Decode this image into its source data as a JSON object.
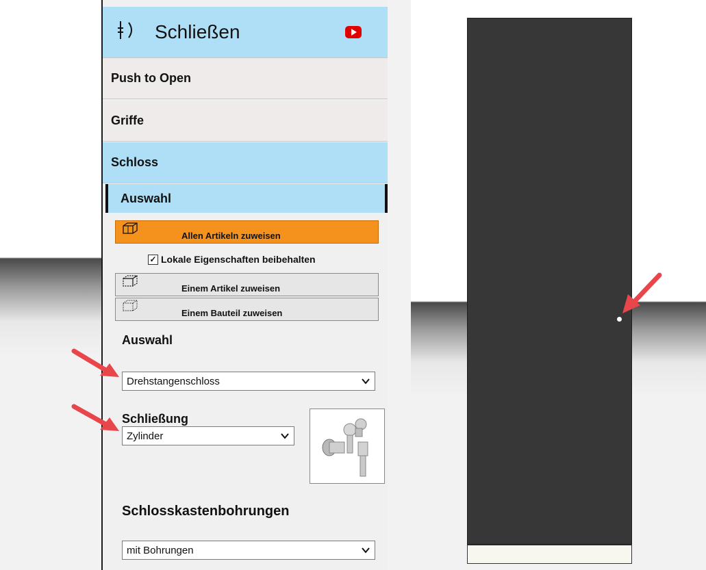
{
  "header": {
    "title": "Schließen",
    "icon": "pipe-bracket-icon",
    "video_icon": "youtube-icon"
  },
  "accordion": {
    "push_to_open": "Push to Open",
    "griffe": "Griffe",
    "schloss": "Schloss"
  },
  "subsection": {
    "title": "Auswahl"
  },
  "assign_buttons": {
    "all_label": "Allen Artikeln zuweisen",
    "one_article_label": "Einem Artikel zuweisen",
    "one_part_label": "Einem Bauteil zuweisen"
  },
  "keep_local": {
    "label": "Lokale Eigenschaften beibehalten",
    "checked": true
  },
  "selection": {
    "label": "Auswahl",
    "value": "Drehstangenschloss"
  },
  "locking": {
    "label": "Schließung",
    "value": "Zylinder",
    "image_icon": "cylinder-lock-keys-icon"
  },
  "holes": {
    "label": "Schlosskastenbohrungen",
    "value": "mit Bohrungen"
  },
  "colors": {
    "accent": "#aedff7",
    "orange": "#f5921e",
    "cabinet": "#373737",
    "arrow": "#e8464a"
  }
}
